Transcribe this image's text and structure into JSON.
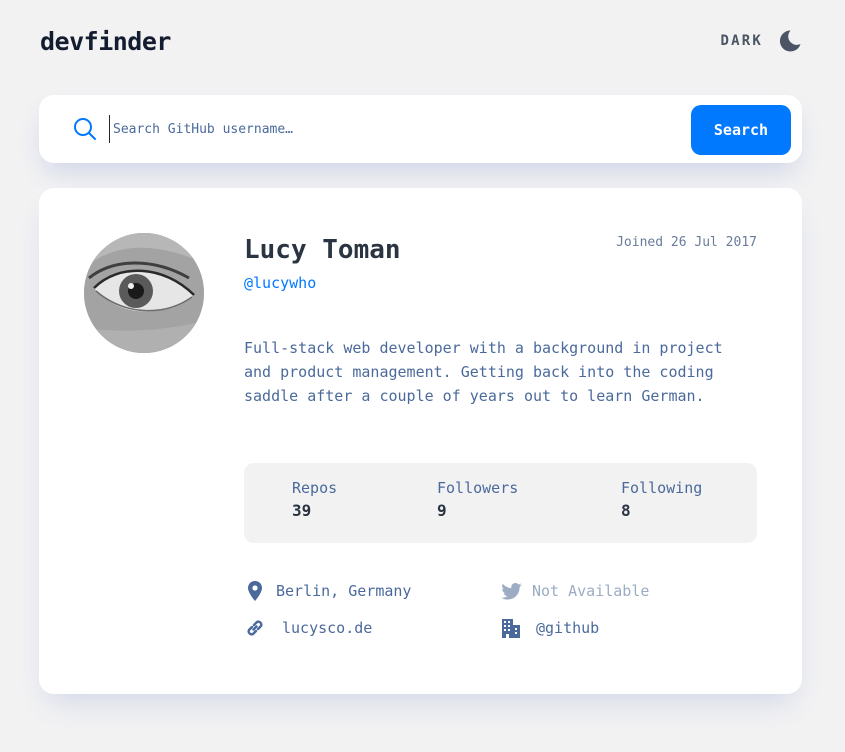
{
  "app": {
    "logo": "devfinder"
  },
  "theme": {
    "label": "DARK",
    "icon": "moon-icon"
  },
  "search": {
    "placeholder": "Search GitHub username…",
    "value": "",
    "button_label": "Search",
    "icon": "search-icon"
  },
  "profile": {
    "name": "Lucy Toman",
    "login": "@lucywho",
    "joined": "Joined 26 Jul 2017",
    "bio": "Full-stack web developer with a background in project and product management. Getting back into the coding saddle after a couple of years out to learn German.",
    "avatar_description": "eye-photo-avatar"
  },
  "stats": [
    {
      "label": "Repos",
      "value": "39"
    },
    {
      "label": "Followers",
      "value": "9"
    },
    {
      "label": "Following",
      "value": "8"
    }
  ],
  "links": {
    "location": {
      "text": "Berlin, Germany",
      "icon": "location-pin-icon"
    },
    "twitter": {
      "text": "Not Available",
      "icon": "twitter-icon",
      "available": false
    },
    "website": {
      "text": "lucysco.de",
      "icon": "link-icon"
    },
    "company": {
      "text": "@github",
      "icon": "building-icon"
    }
  },
  "colors": {
    "accent": "#0079ff",
    "background": "#f2f2f3",
    "card": "#ffffff",
    "text_primary": "#2b3442",
    "text_secondary": "#4b6a9b",
    "muted": "#9cacc4"
  }
}
